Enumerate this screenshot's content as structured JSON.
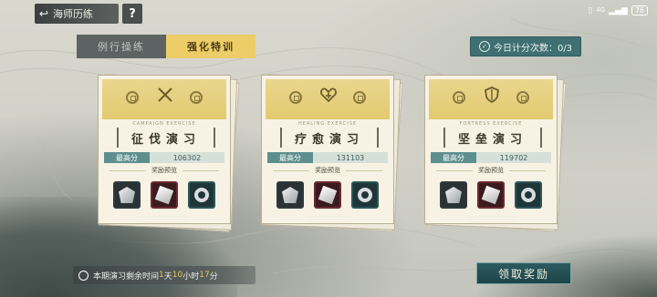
{
  "topbar": {
    "back_label": "海师历练",
    "help_label": "?",
    "status": {
      "network": "4G",
      "battery": "76"
    }
  },
  "tabs": [
    {
      "label": "例行操练",
      "active": false
    },
    {
      "label": "强化特训",
      "active": true
    }
  ],
  "counter": {
    "label": "今日计分次数：0/3"
  },
  "cards": [
    {
      "subtitle": "CAMPAIGN EXERCISE",
      "title": "征伐演习",
      "emblem": "crossed-swords-icon",
      "highscore_label": "最高分",
      "highscore": "106302",
      "reward_label": "奖励预览",
      "items": [
        "gem-item",
        "cube-item",
        "ring-item"
      ]
    },
    {
      "subtitle": "HEALING EXERCISE",
      "title": "疗愈演习",
      "emblem": "heart-icon",
      "highscore_label": "最高分",
      "highscore": "131103",
      "reward_label": "奖励预览",
      "items": [
        "gem-item",
        "cube-item",
        "ring-item"
      ]
    },
    {
      "subtitle": "FORTRESS EXERCISE",
      "title": "坚垒演习",
      "emblem": "shield-icon",
      "highscore_label": "最高分",
      "highscore": "119702",
      "reward_label": "奖励预览",
      "items": [
        "gem-item",
        "cube-item",
        "ring-item"
      ]
    }
  ],
  "timer": {
    "prefix": "本期演习剩余时间",
    "d": "1",
    "d_unit": "天",
    "h": "10",
    "h_unit": "小时",
    "m": "17",
    "m_unit": "分"
  },
  "claim_button": {
    "label": "领取奖励"
  },
  "colors": {
    "accent_gold": "#eccd68",
    "teal": "#3e6f73"
  }
}
